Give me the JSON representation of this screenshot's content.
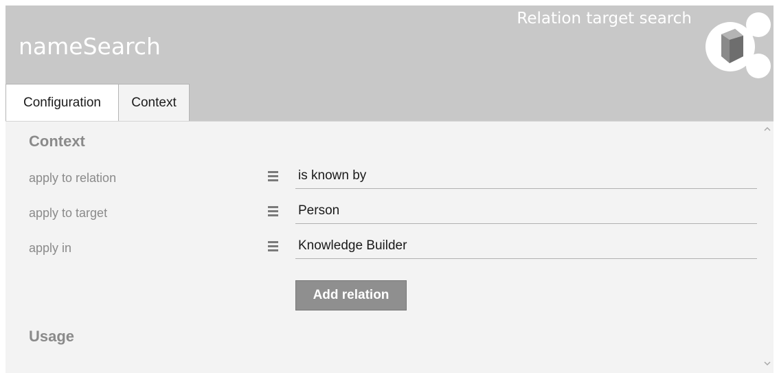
{
  "header": {
    "title": "nameSearch",
    "type_label": "Relation target search",
    "logo_icon": "relation-network-icon"
  },
  "tabs": [
    {
      "label": "Configuration",
      "selected": false
    },
    {
      "label": "Context",
      "selected": true
    }
  ],
  "context": {
    "heading": "Context",
    "rows": [
      {
        "label": "apply to relation",
        "value": "is known by",
        "menu_icon": "hamburger-menu-icon"
      },
      {
        "label": "apply to target",
        "value": "Person",
        "menu_icon": "hamburger-menu-icon"
      },
      {
        "label": "apply in",
        "value": "Knowledge Builder",
        "menu_icon": "hamburger-menu-icon"
      }
    ],
    "add_button_label": "Add relation"
  },
  "usage": {
    "heading": "Usage"
  },
  "colors": {
    "header_bg": "#c8c8c8",
    "content_bg": "#f3f3f3",
    "button_bg": "#8f8f8f",
    "label_gray": "#8a8a8a"
  }
}
